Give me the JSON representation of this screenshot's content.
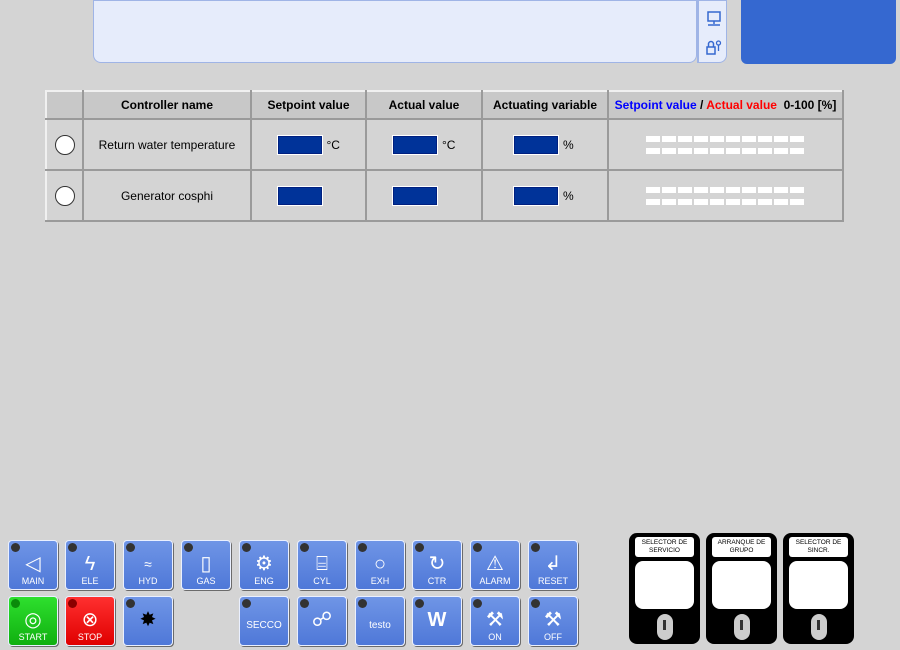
{
  "header": {
    "message_text": "",
    "icons": [
      "network-icon",
      "lock-key-icon"
    ]
  },
  "table": {
    "columns": [
      "",
      "Controller name",
      "Setpoint value",
      "Actual value",
      "Actuating variable"
    ],
    "legend": {
      "setpoint": "Setpoint value",
      "separator": " / ",
      "actual": "Actual value",
      "range": "0-100 [%]"
    },
    "rows": [
      {
        "name": "Return water temperature",
        "setpoint_unit": "°C",
        "actual_unit": "°C",
        "actuating_unit": "%"
      },
      {
        "name": "Generator cosphi",
        "setpoint_unit": "",
        "actual_unit": "",
        "actuating_unit": "%"
      }
    ]
  },
  "buttons": {
    "main": "MAIN",
    "ele": "ELE",
    "hyd": "HYD",
    "gas": "GAS",
    "eng": "ENG",
    "cyl": "CYL",
    "exh": "EXH",
    "ctr": "CTR",
    "alarm": "ALARM",
    "reset": "RESET",
    "start": "START",
    "stop": "STOP",
    "secco": "SECCO",
    "testo": "testo",
    "on": "ON",
    "off": "OFF"
  },
  "selectors": [
    {
      "title": "SELECTOR DE SERVICIO"
    },
    {
      "title": "ARRANQUE DE GRUPO"
    },
    {
      "title": "SELECTOR DE SINCR."
    }
  ],
  "colors": {
    "accent": "#3568d0",
    "value_box": "#003399",
    "start": "#10b010",
    "stop": "#e00000"
  }
}
